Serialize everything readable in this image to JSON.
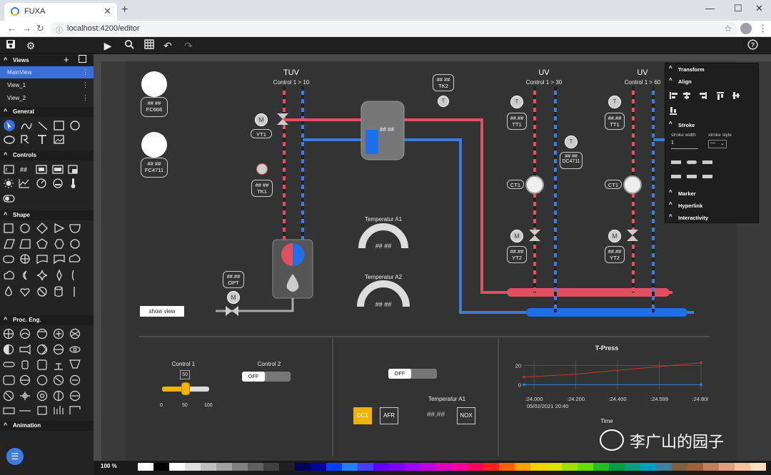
{
  "browser": {
    "tab_title": "FUXA",
    "url": "localhost:4200/editor",
    "new_tab": "+",
    "minimize": "—",
    "maximize": "☐",
    "close": "✕"
  },
  "sidebar": {
    "views_label": "Views",
    "views": [
      {
        "label": "MainView",
        "active": true
      },
      {
        "label": "View_1",
        "active": false
      },
      {
        "label": "View_2",
        "active": false
      }
    ],
    "general_label": "General",
    "controls_label": "Controls",
    "shape_label": "Shape",
    "proc_label": "Proc. Eng.",
    "animation_label": "Animation"
  },
  "props": {
    "transform": "Transform",
    "align": "Align",
    "stroke": "Stroke",
    "stroke_width_label": "stroke width",
    "stroke_style_label": "stroke style",
    "stroke_width_value": "1",
    "stroke_style_value": "—",
    "marker": "Marker",
    "hyperlink": "Hyperlink",
    "interactivity": "Interactivity"
  },
  "status": {
    "zoom": "100 %"
  },
  "canvas": {
    "fc666": {
      "value": "## ##",
      "label": "FC666"
    },
    "fc4711": {
      "value": "## ##",
      "label": "FC4711"
    },
    "tuv": {
      "title": "TUV",
      "sub": "Control 1 > 10"
    },
    "uv1": {
      "title": "UV",
      "sub": "Control 1 > 30"
    },
    "uv2": {
      "title": "UV",
      "sub": "Control 1 > 60"
    },
    "m_label": "M",
    "t_label": "T",
    "yt1": "YT1",
    "tk1_value": "## ##",
    "tk1": "TK1",
    "tk2_value": "## ##",
    "tk2": "TK2",
    "tank_value": "## ##",
    "tt1_value": "##.##",
    "tt1": "TT1",
    "dc4711_value": "## ##",
    "dc4711": "DC4711",
    "ct1": "CT1",
    "yt2_value": "##.##",
    "yt2": "YT2",
    "opt_value": "##.##",
    "opt": "OPT",
    "temp_a1": "Temperatur A1",
    "temp_a1_value": "## ##",
    "temp_a2": "Temperatur A2",
    "temp_a2_value": "## ##",
    "show_view": "show view",
    "control1": "Control 1",
    "control1_value": "50",
    "slider_ticks": [
      "0",
      "50",
      "100"
    ],
    "control2": "Control 2",
    "off": "OFF",
    "temp_a1_b": "Temperatur A1",
    "temp_a1_b_value": "##.##",
    "btn_dc1": "DC1",
    "btn_afr": "AFR",
    "btn_nox": "NOX"
  },
  "chart_data": {
    "type": "line",
    "title": "T-Press",
    "xlabel": "Time",
    "ylabel": "",
    "x": [
      ":24.000",
      ":24.200",
      ":24.400",
      ":24.599",
      ":24.800"
    ],
    "x_sub": "05/02/2021 20:40",
    "yticks": [
      "20",
      "0"
    ],
    "ylim": [
      -5,
      25
    ],
    "series": [
      {
        "name": "",
        "color": "#c0392b",
        "values": [
          8,
          11,
          15,
          19,
          23
        ]
      },
      {
        "name": "",
        "color": "#3b7ddd",
        "values": [
          0,
          0,
          0,
          0,
          0
        ]
      }
    ]
  },
  "watermark": "李广山的园子",
  "colors": {
    "hot": "#e05060",
    "cold": "#3b7ddd",
    "accent": "#3a6fd8",
    "active_btn": "#f0b400"
  }
}
